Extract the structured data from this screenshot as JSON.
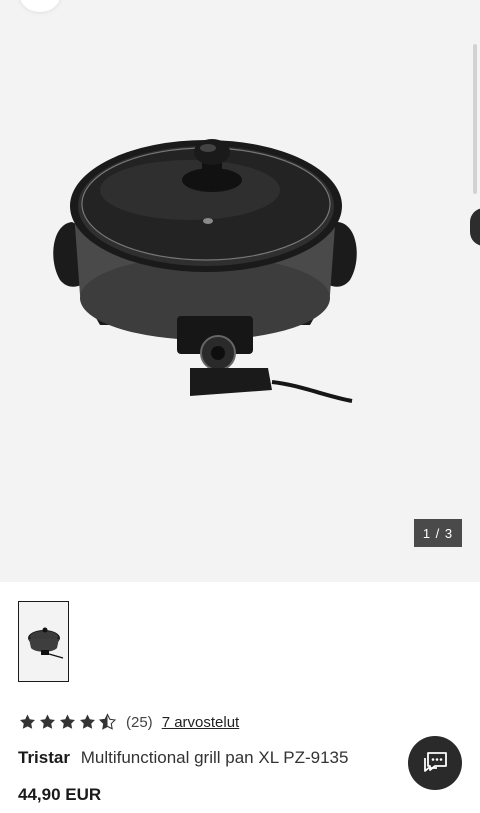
{
  "gallery": {
    "counter": "1 / 3",
    "image_icon": "electric-grill-pan-image",
    "thumbnail_icon": "grill-pan-thumbnail"
  },
  "rating": {
    "stars": 4.5,
    "count": "(25)",
    "reviews_link": "7 arvostelut"
  },
  "product": {
    "brand": "Tristar",
    "name": "Multifunctional grill pan XL PZ-9135",
    "price": "44,90 EUR"
  },
  "chat": {
    "icon": "chat-icon"
  },
  "colors": {
    "gallery_bg": "#f3f3f3",
    "counter_bg": "#4a4a4a",
    "chat_bg": "#2a2a2a",
    "star": "#333333"
  }
}
